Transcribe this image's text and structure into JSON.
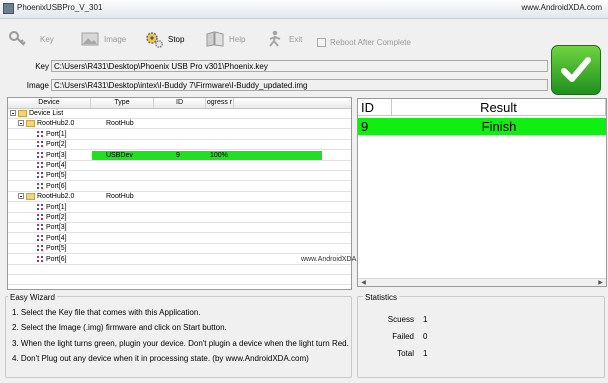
{
  "window": {
    "title": "PhoenixUSBPro_V_301",
    "watermark": "www.AndroidXDA.com"
  },
  "toolbar": {
    "key": {
      "label": "Key",
      "icon": "key-icon"
    },
    "image": {
      "label": "Image",
      "icon": "image-icon"
    },
    "stop": {
      "label": "Stop",
      "icon": "gears-icon"
    },
    "help": {
      "label": "Help",
      "icon": "book-icon"
    },
    "exit": {
      "label": "Exit",
      "icon": "exit-icon"
    },
    "reboot_label": "Reboot After Complete"
  },
  "paths": {
    "key_label": "Key",
    "key_value": "C:\\Users\\R431\\Desktop\\Phoenix USB Pro v301\\Phoenix.key",
    "image_label": "Image",
    "image_value": "C:\\Users\\R431\\Desktop\\intex\\I-Buddy 7\\Firmware\\I-Buddy_updated.img"
  },
  "device_grid": {
    "columns": [
      "Device",
      "Type",
      "ID",
      "ogress r"
    ],
    "root_label": "Device List",
    "hubs": [
      {
        "label": "RootHub2.0",
        "type": "RootHub",
        "ports": [
          "Port[1]",
          "Port[2]",
          "Port[3]",
          "Port[4]",
          "Port[5]",
          "Port[6]"
        ]
      },
      {
        "label": "RootHub2.0",
        "type": "RootHub",
        "ports": [
          "Port[1]",
          "Port[2]",
          "Port[3]",
          "Port[4]",
          "Port[5]",
          "Port[6]"
        ]
      }
    ],
    "active_device": {
      "type": "USBDev",
      "id": "9",
      "progress": "100%"
    }
  },
  "watermark_mid": "www.AndroidXDA.com",
  "result_grid": {
    "id_header": "ID",
    "result_header": "Result",
    "row": {
      "id": "9",
      "result": "Finish"
    }
  },
  "wizard": {
    "title": "Easy Wizard",
    "lines": [
      "1. Select the Key file that comes with this Application.",
      "2. Select the Image (.img) firmware and click on Start button.",
      "3. When the light turns green, plugin your device. Don't plugin a device when the light turn Red.",
      "4. Don't Plug out any device when it in processing state. (by www.AndroidXDA.com)"
    ]
  },
  "statistics": {
    "title": "Statistics",
    "success_label": "Scuess",
    "success_value": "1",
    "failed_label": "Failed",
    "failed_value": "0",
    "total_label": "Total",
    "total_value": "1"
  },
  "colors": {
    "active_row": "#1fe11f",
    "result_row": "#11ee11",
    "status_light": "#33b52d"
  }
}
